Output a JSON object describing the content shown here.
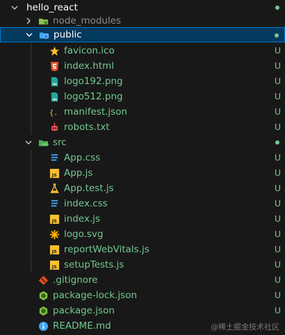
{
  "explorer": {
    "root": {
      "label": "hello_react"
    },
    "node_modules": {
      "label": "node_modules"
    },
    "public": {
      "label": "public",
      "files": [
        {
          "label": "favicon.ico",
          "icon": "star-icon",
          "status": "U"
        },
        {
          "label": "index.html",
          "icon": "html5-icon",
          "status": "U"
        },
        {
          "label": "logo192.png",
          "icon": "image-icon",
          "status": "U"
        },
        {
          "label": "logo512.png",
          "icon": "image-icon",
          "status": "U"
        },
        {
          "label": "manifest.json",
          "icon": "json-braces-icon",
          "status": "U"
        },
        {
          "label": "robots.txt",
          "icon": "robot-icon",
          "status": "U"
        }
      ]
    },
    "src": {
      "label": "src",
      "files": [
        {
          "label": "App.css",
          "icon": "css-icon",
          "status": "U"
        },
        {
          "label": "App.js",
          "icon": "js-icon",
          "status": "U"
        },
        {
          "label": "App.test.js",
          "icon": "flask-icon",
          "status": "U"
        },
        {
          "label": "index.css",
          "icon": "css-icon",
          "status": "U"
        },
        {
          "label": "index.js",
          "icon": "js-icon",
          "status": "U"
        },
        {
          "label": "logo.svg",
          "icon": "svg-sparkle-icon",
          "status": "U"
        },
        {
          "label": "reportWebVitals.js",
          "icon": "js-icon",
          "status": "U"
        },
        {
          "label": "setupTests.js",
          "icon": "js-icon",
          "status": "U"
        }
      ]
    },
    "root_files": [
      {
        "label": ".gitignore",
        "icon": "git-icon",
        "status": "U"
      },
      {
        "label": "package-lock.json",
        "icon": "node-icon",
        "status": "U"
      },
      {
        "label": "package.json",
        "icon": "node-icon",
        "status": "U"
      },
      {
        "label": "README.md",
        "icon": "info-icon",
        "status": "U"
      }
    ]
  },
  "watermark": "@稀土掘金技术社区",
  "colors": {
    "background": "#181818",
    "selection": "#04395e",
    "selection_border": "#0078d4",
    "untracked": "#73c991",
    "folder_text": "#cccccc"
  }
}
